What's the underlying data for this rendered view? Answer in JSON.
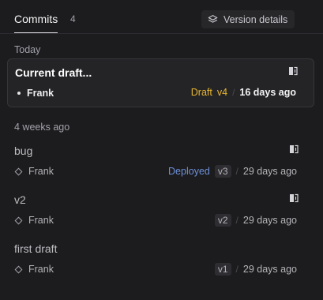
{
  "header": {
    "tab_label": "Commits",
    "tab_count": "4",
    "version_button_label": "Version details"
  },
  "groups": [
    {
      "label": "Today",
      "commits": [
        {
          "title": "Current draft...",
          "author": "Frank",
          "status": "Draft",
          "version": "v4",
          "date": "16 days ago"
        }
      ]
    },
    {
      "label": "4 weeks ago",
      "commits": [
        {
          "title": "bug",
          "author": "Frank",
          "status": "Deployed",
          "version": "v3",
          "date": "29 days ago"
        },
        {
          "title": "v2",
          "author": "Frank",
          "status": "",
          "version": "v2",
          "date": "29 days ago"
        },
        {
          "title": "first draft",
          "author": "Frank",
          "status": "",
          "version": "v1",
          "date": "29 days ago"
        }
      ]
    }
  ],
  "colors": {
    "background": "#1c1c1e",
    "draft": "#e5b62f",
    "deployed": "#6d8fd8"
  },
  "icons": {
    "version_button": "layers-icon",
    "commit_action": "restore-icon"
  }
}
